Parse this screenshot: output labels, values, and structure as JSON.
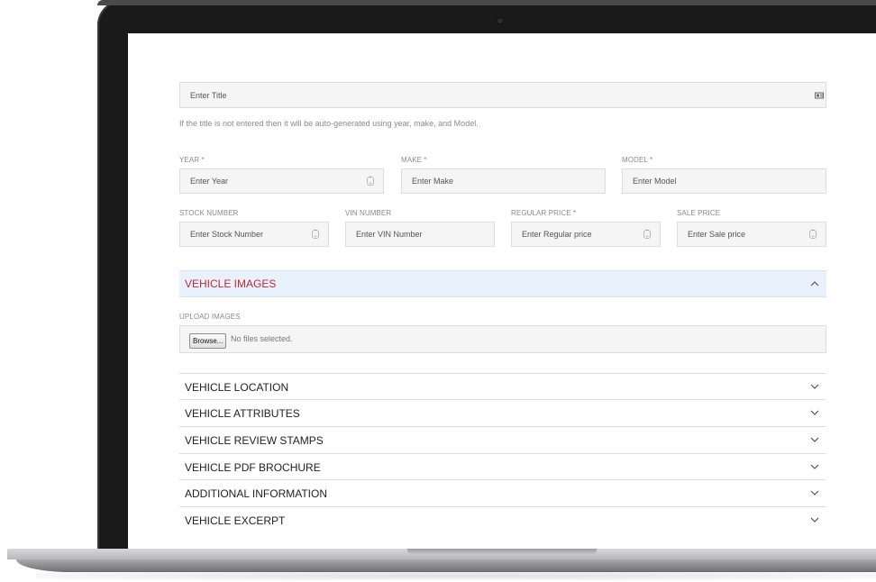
{
  "title_field": {
    "placeholder": "Enter Title",
    "icon": "id-card-icon"
  },
  "title_help": "If the title is not entered then it will be auto-generated using year, make, and Model.",
  "row1": {
    "year": {
      "label": "YEAR *",
      "placeholder": "Enter Year"
    },
    "make": {
      "label": "MAKE *",
      "placeholder": "Enter Make"
    },
    "model": {
      "label": "MODEL *",
      "placeholder": "Enter Model"
    }
  },
  "row2": {
    "stock": {
      "label": "STOCK NUMBER",
      "placeholder": "Enter Stock Number"
    },
    "vin": {
      "label": "VIN NUMBER",
      "placeholder": "Enter VIN Number"
    },
    "regular_price": {
      "label": "REGULAR PRICE *",
      "placeholder": "Enter Regular price"
    },
    "sale_price": {
      "label": "SALE PRICE",
      "placeholder": "Enter Sale price"
    }
  },
  "images_section": {
    "title": "VEHICLE IMAGES",
    "upload_label": "UPLOAD IMAGES",
    "browse_label": "Browse...",
    "no_file_text": "No files selected."
  },
  "accordion": [
    {
      "title": "VEHICLE LOCATION"
    },
    {
      "title": "VEHICLE ATTRIBUTES"
    },
    {
      "title": "VEHICLE REVIEW STAMPS"
    },
    {
      "title": "VEHICLE PDF BROCHURE"
    },
    {
      "title": "ADDITIONAL INFORMATION"
    },
    {
      "title": "VEHICLE EXCERPT"
    }
  ],
  "colors": {
    "accent": "#c62828",
    "section_bg": "#e9f1fd",
    "input_bg": "#f5f5f5"
  }
}
